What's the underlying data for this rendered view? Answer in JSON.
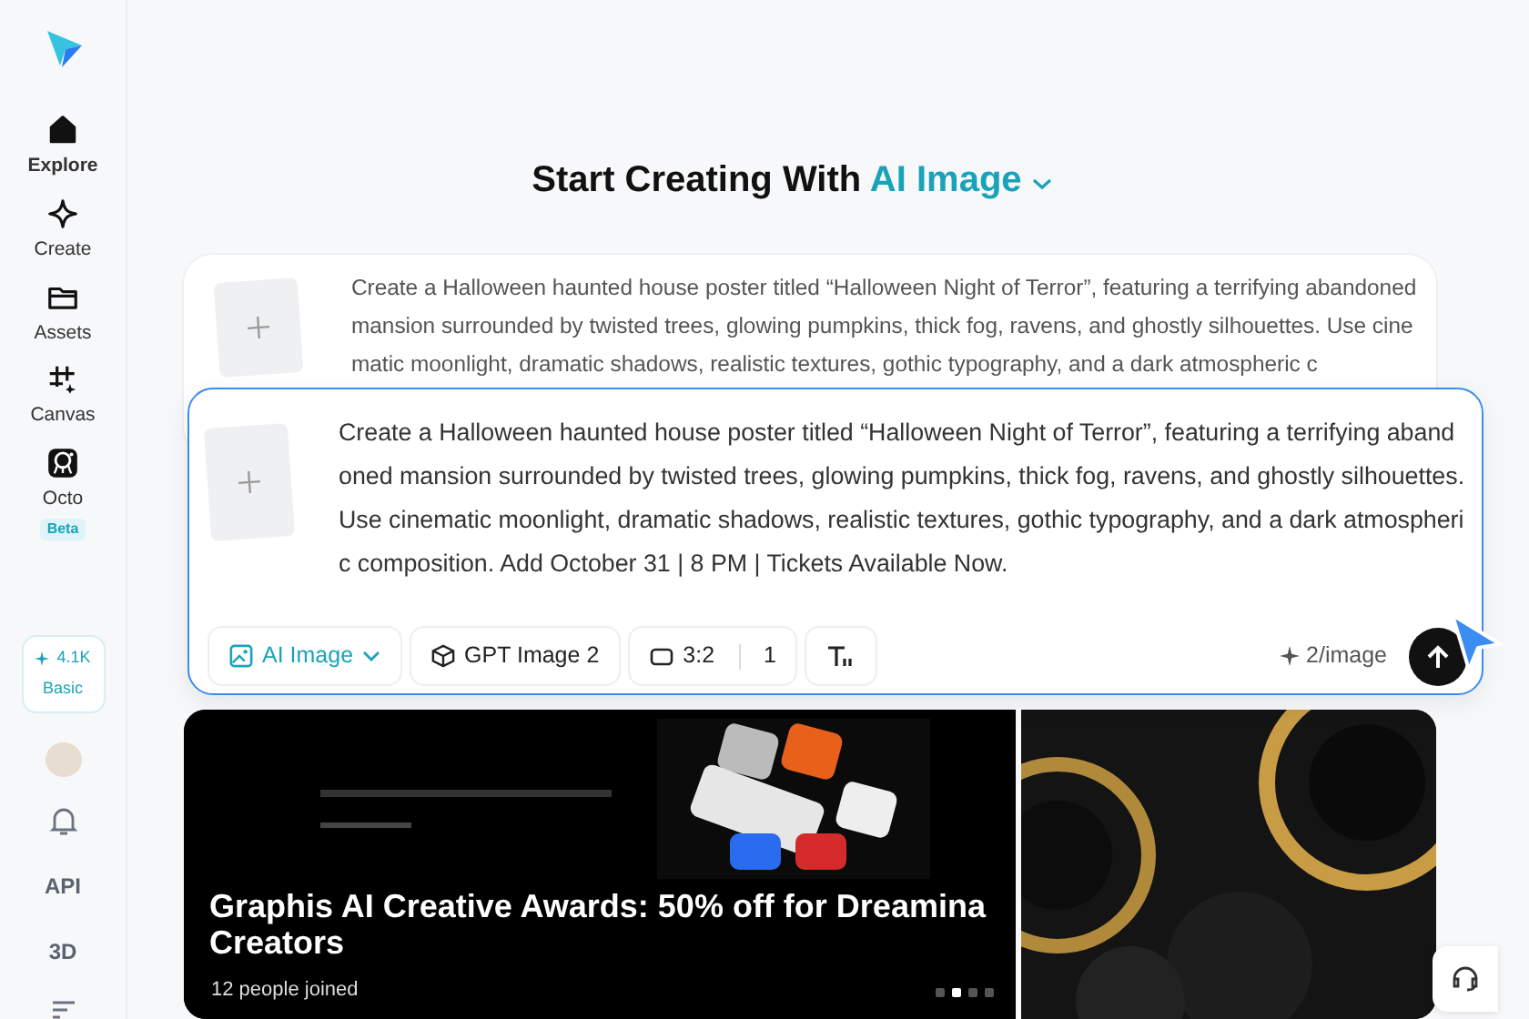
{
  "sidebar": {
    "items": [
      {
        "label": "Explore",
        "selected": true
      },
      {
        "label": "Create",
        "selected": false
      },
      {
        "label": "Assets",
        "selected": false
      },
      {
        "label": "Canvas",
        "selected": false
      },
      {
        "label": "Octo",
        "selected": false,
        "badge": "Beta"
      }
    ],
    "credits": {
      "amount": "4.1K",
      "plan": "Basic"
    },
    "bottom": [
      {
        "kind": "bell"
      },
      {
        "kind": "text",
        "label": "API"
      },
      {
        "kind": "text",
        "label": "3D"
      },
      {
        "kind": "menu"
      }
    ]
  },
  "heading": {
    "text": "Start Creating With",
    "mode": "AI Image"
  },
  "previous_prompt": {
    "text": "Create a Halloween haunted house poster titled “Halloween Night of Terror”, featuring a terrifying abandoned mansion surrounded by twisted trees, glowing pumpkins, thick fog, ravens, and ghostly silhouettes. Use cinematic moonlight, dramatic shadows, realistic textures, gothic typography, and a dark atmospheric c"
  },
  "prompt": {
    "text": "Create a Halloween haunted house poster titled “Halloween Night of Terror”, featuring a terrifying abandoned mansion surrounded by twisted trees, glowing pumpkins, thick fog, ravens, and ghostly silhouettes. Use cinematic moonlight, dramatic shadows, realistic textures, gothic typography, and a dark atmospheric composition. Add October 31 | 8 PM | Tickets Available Now.",
    "mode": "AI Image",
    "model": "GPT Image 2",
    "ratio": "3:2",
    "count": "1",
    "cost": "2/image"
  },
  "banner": {
    "title": "Graphis AI Creative Awards: 50% off for Dreamina Creators",
    "joined": "12 people joined",
    "dots": [
      {
        "selected": false
      },
      {
        "selected": true
      },
      {
        "selected": false
      },
      {
        "selected": false
      }
    ]
  }
}
